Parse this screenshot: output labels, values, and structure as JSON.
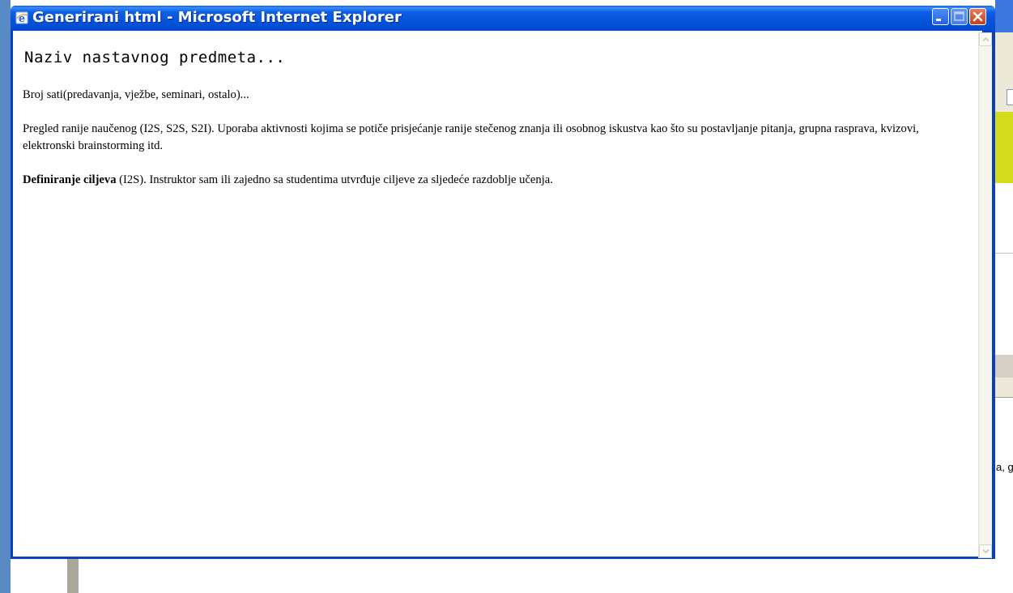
{
  "window": {
    "title": "Generirani html - Microsoft Internet Explorer",
    "title_bar_color": "#0453db"
  },
  "document": {
    "title": "Naziv nastavnog predmeta...",
    "hours_line": "Broj sati(predavanja, vježbe, seminari, ostalo)...",
    "review_paragraph": "Pregled ranije naučenog (I2S, S2S, S2I). Uporaba aktivnosti kojima se potiče prisjećanje ranije stečenog znanja ili osobnog iskustva kao što su postavljanje pitanja, grupna rasprava, kvizovi, elektronski brainstorming itd.",
    "goals_bold": "Definiranje ciljeva",
    "goals_rest": " (I2S). Instruktor sam ili zajedno sa studentima utvrđuje ciljeve za sljedeće razdoblje učenja."
  },
  "background_window": {
    "visible_text_fragment": "a, g"
  },
  "icons": {
    "title_icon": "internet-explorer-icon",
    "minimize": "minimize-icon",
    "maximize": "maximize-icon",
    "close": "close-icon",
    "scroll_up": "chevron-up-icon",
    "scroll_down": "chevron-down-icon"
  }
}
